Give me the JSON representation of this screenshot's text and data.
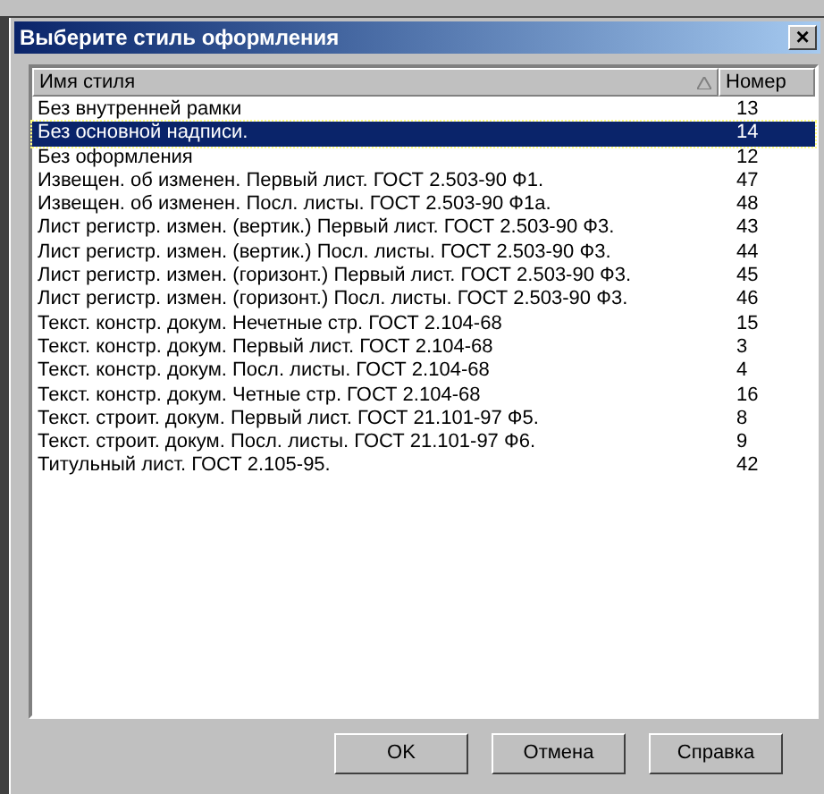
{
  "window": {
    "title": "Выберите стиль оформления",
    "close": "×"
  },
  "table": {
    "columns": [
      {
        "label": "Имя стиля",
        "sorted": true
      },
      {
        "label": "Номер",
        "sorted": false
      }
    ],
    "rows": [
      {
        "name": "Без внутренней рамки",
        "number": "13",
        "selected": false
      },
      {
        "name": "Без основной надписи.",
        "number": "14",
        "selected": true
      },
      {
        "name": "Без оформления",
        "number": "12",
        "selected": false
      },
      {
        "name": "Извещен. об изменен. Первый лист. ГОСТ 2.503-90 Ф1.",
        "number": "47",
        "selected": false
      },
      {
        "name": "Извещен. об изменен. Посл. листы. ГОСТ 2.503-90 Ф1а.",
        "number": "48",
        "selected": false
      },
      {
        "name": "Лист регистр. измен. (вертик.) Первый лист. ГОСТ 2.503-90 Ф3.",
        "number": "43",
        "selected": false
      },
      {
        "name": "Лист регистр. измен. (вертик.) Посл. листы. ГОСТ 2.503-90 Ф3.",
        "number": "44",
        "selected": false
      },
      {
        "name": "Лист регистр. измен. (горизонт.) Первый лист. ГОСТ 2.503-90 Ф3.",
        "number": "45",
        "selected": false
      },
      {
        "name": "Лист регистр. измен. (горизонт.) Посл. листы. ГОСТ 2.503-90 Ф3.",
        "number": "46",
        "selected": false
      },
      {
        "name": "Текст. констр. докум. Нечетные стр. ГОСТ 2.104-68",
        "number": "15",
        "selected": false
      },
      {
        "name": "Текст. констр. докум. Первый лист. ГОСТ 2.104-68",
        "number": "3",
        "selected": false
      },
      {
        "name": "Текст. констр. докум. Посл. листы. ГОСТ 2.104-68",
        "number": "4",
        "selected": false
      },
      {
        "name": "Текст. констр. докум. Четные стр. ГОСТ 2.104-68",
        "number": "16",
        "selected": false
      },
      {
        "name": "Текст. строит. докум. Первый лист. ГОСТ 21.101-97 Ф5.",
        "number": "8",
        "selected": false
      },
      {
        "name": "Текст. строит. докум. Посл. листы. ГОСТ 21.101-97 Ф6.",
        "number": "9",
        "selected": false
      },
      {
        "name": "Титульный лист. ГОСТ 2.105-95.",
        "number": "42",
        "selected": false
      }
    ]
  },
  "buttons": [
    "OK",
    "Отмена",
    "Справка"
  ]
}
